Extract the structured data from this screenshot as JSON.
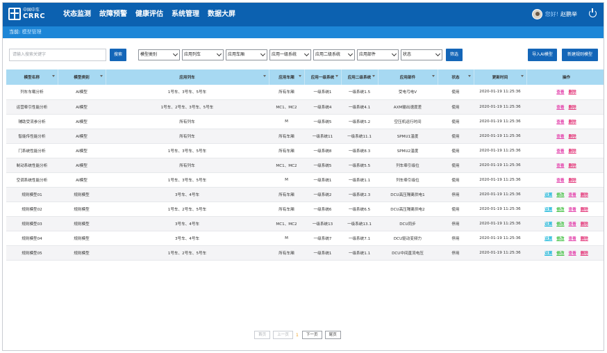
{
  "header": {
    "logo_cn": "中国中车",
    "logo_en": "CRRC",
    "nav": [
      "状态监测",
      "故障预警",
      "健康评估",
      "系统管理",
      "数据大屏"
    ],
    "greeting": "您好!",
    "username": "赵鹏举"
  },
  "breadcrumb": {
    "prefix": "当前:",
    "current": "模型管理"
  },
  "toolbar": {
    "search_placeholder": "请输入搜索关键字",
    "search_button": "搜索",
    "filters": [
      "模型类别",
      "应用列车",
      "应用车厢",
      "应用一级系统",
      "应用二级系统",
      "应用部件",
      "状态"
    ],
    "filter_button": "筛选",
    "import_button": "导入AI模型",
    "new_button": "新建规则模型"
  },
  "table": {
    "headers": [
      "模型名称",
      "模型类别",
      "应用列车",
      "应用车厢",
      "应用一级系统",
      "应用二级系统",
      "应用部件",
      "状态",
      "更新时间",
      "操作"
    ],
    "rows": [
      [
        "列车车载分析",
        "AI模型",
        "1号车、3号车、5号车",
        "所有车厢",
        "一级系统1",
        "一级系统1.5",
        "受电弓电V",
        "使用",
        "2020-01-19 11:25:36"
      ],
      [
        "运营牵引性能分析",
        "AI模型",
        "1号车、2号车、3号车、5号车",
        "MC1、MC2",
        "一级系统4",
        "一级系统4.1",
        "AXM输出速度差",
        "使用",
        "2020-01-19 11:25:36"
      ],
      [
        "辅助受流参分析",
        "AI模型",
        "所有列车",
        "M",
        "一级系统5",
        "一级系统5.2",
        "空压机运行时间",
        "使用",
        "2020-01-19 11:25:36"
      ],
      [
        "智能传性能分析",
        "AI模型",
        "所有列车",
        "所有车厢",
        "一级系统11",
        "一级系统11.1",
        "SPMU1温度",
        "使用",
        "2020-01-19 11:25:36"
      ],
      [
        "门系统性能分析",
        "AI模型",
        "1号车、3号车、5号车",
        "所有车厢",
        "一级系统8",
        "一级系统8.3",
        "SPMU2温度",
        "使用",
        "2020-01-19 11:25:36"
      ],
      [
        "制动系统性能分析",
        "AI模型",
        "所有列车",
        "MC1、MC2",
        "一级系统5",
        "一级系统5.5",
        "列车牵引级位",
        "使用",
        "2020-01-19 11:25:36"
      ],
      [
        "空调系统性能分析",
        "AI模型",
        "1号车、3号车、5号车",
        "M",
        "一级系统1",
        "一级系统1.1",
        "列车牵引级位",
        "使用",
        "2020-01-19 11:25:36"
      ],
      [
        "规则模型01",
        "规则模型",
        "3号车、4号车",
        "所有车厢",
        "一级系统2",
        "一级系统2.3",
        "DCU高压隔离供电1",
        "停用",
        "2020-01-19 11:25:36"
      ],
      [
        "规则模型02",
        "规则模型",
        "1号车、2号车、5号车",
        "所有车厢",
        "一级系统6",
        "一级系统6.5",
        "DCU高压隔离供电2",
        "使用",
        "2020-01-19 11:25:36"
      ],
      [
        "规则模型03",
        "规则模型",
        "3号车、4号车",
        "MC1、MC2",
        "一级系统13",
        "一级系统13.1",
        "DCU同步",
        "停用",
        "2020-01-19 11:25:36"
      ],
      [
        "规则模型04",
        "规则模型",
        "3号车、4号车",
        "M",
        "一级系统7",
        "一级系统7.1",
        "DCU驱动变频力",
        "停用",
        "2020-01-19 11:25:36"
      ],
      [
        "规则模型05",
        "规则模型",
        "1号车、2号车、5号车",
        "所有车厢",
        "一级系统1",
        "一级系统1.1",
        "DCU中间直流电压",
        "停用",
        "2020-01-19 11:25:36"
      ]
    ],
    "actions_ai": [
      "查看",
      "删除"
    ],
    "actions_rule": [
      "运算",
      "修改",
      "查看",
      "删除"
    ]
  },
  "pagination": {
    "first": "首页",
    "prev": "上一页",
    "current": "1",
    "next": "下一页",
    "last": "尾页"
  },
  "colors": {
    "topbar": "#0c61b0",
    "crumbbar": "#1d86d7",
    "header_row": "#a7d9f2",
    "button": "#1466b8"
  }
}
